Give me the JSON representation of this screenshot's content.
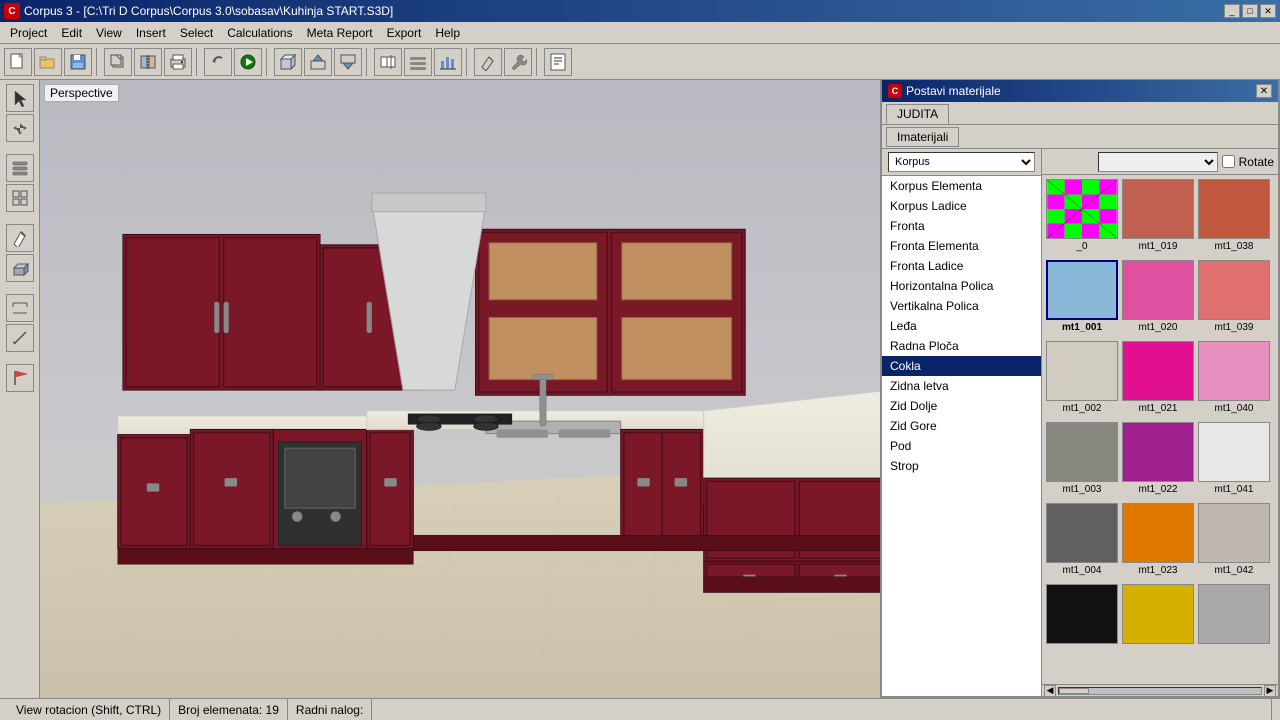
{
  "titlebar": {
    "icon": "C",
    "text": "Corpus 3 - [C:\\Tri D Corpus\\Corpus 3.0\\sobasav\\Kuhinja START.S3D]",
    "controls": [
      "_",
      "□",
      "✕"
    ]
  },
  "menubar": {
    "items": [
      "Project",
      "Edit",
      "View",
      "Insert",
      "Select",
      "Calculations",
      "Meta Report",
      "Export",
      "Help"
    ]
  },
  "toolbar": {
    "buttons": [
      "📄",
      "📁",
      "💾",
      "📋",
      "✂️",
      "🖨️",
      "↺",
      "▶",
      "📦",
      "📤",
      "📥",
      "📑",
      "📊",
      "📈",
      "✏️",
      "🔧"
    ]
  },
  "viewport": {
    "label": "Perspective"
  },
  "status": {
    "action": "View rotacion (Shift, CTRL)",
    "elements": "Broj elemenata: 19",
    "radni": "Radni nalog:"
  },
  "material_panel": {
    "title": "Postavi materijale",
    "close": "✕",
    "tabs": [
      {
        "label": "JUDITA",
        "active": true
      },
      {
        "label": "Imaterijali",
        "active": false
      }
    ],
    "parts_header": "Korpus",
    "parts": [
      {
        "label": "Korpus Elementa",
        "selected": false
      },
      {
        "label": "Korpus Ladice",
        "selected": false
      },
      {
        "label": "Fronta",
        "selected": false
      },
      {
        "label": "Fronta Elementa",
        "selected": false
      },
      {
        "label": "Fronta Ladice",
        "selected": false
      },
      {
        "label": "Horizontalna Polica",
        "selected": false
      },
      {
        "label": "Vertikalna Polica",
        "selected": false
      },
      {
        "label": "Leđa",
        "selected": false
      },
      {
        "label": "Radna Ploča",
        "selected": false
      },
      {
        "label": "Cokla",
        "selected": true
      },
      {
        "label": "Zidna letva",
        "selected": false
      },
      {
        "label": "Zid Dolje",
        "selected": false
      },
      {
        "label": "Zid Gore",
        "selected": false
      },
      {
        "label": "Pod",
        "selected": false
      },
      {
        "label": "Strop",
        "selected": false
      }
    ],
    "rotate_label": "Rotate",
    "materials": [
      [
        {
          "id": "_0",
          "color": "checker",
          "selected": false
        },
        {
          "id": "mt1_019",
          "color": "#c06050",
          "selected": false
        },
        {
          "id": "mt1_038",
          "color": "#c05840",
          "selected": false
        }
      ],
      [
        {
          "id": "mt1_001",
          "color": "#8ab8d8",
          "selected": true
        },
        {
          "id": "mt1_020",
          "color": "#e050a0",
          "selected": false
        },
        {
          "id": "mt1_039",
          "color": "#e07070",
          "selected": false
        }
      ],
      [
        {
          "id": "mt1_002",
          "color": "#d0ccc0",
          "selected": false
        },
        {
          "id": "mt1_021",
          "color": "#e01090",
          "selected": false
        },
        {
          "id": "mt1_040",
          "color": "#e890c0",
          "selected": false
        }
      ],
      [
        {
          "id": "mt1_003",
          "color": "#888880",
          "selected": false
        },
        {
          "id": "mt1_022",
          "color": "#a02090",
          "selected": false
        },
        {
          "id": "mt1_041",
          "color": "#e8e8e8",
          "selected": false
        }
      ],
      [
        {
          "id": "mt1_004",
          "color": "#606060",
          "selected": false
        },
        {
          "id": "mt1_023",
          "color": "#e07800",
          "selected": false
        },
        {
          "id": "mt1_042",
          "color": "#c0b8b0",
          "selected": false
        }
      ]
    ]
  }
}
